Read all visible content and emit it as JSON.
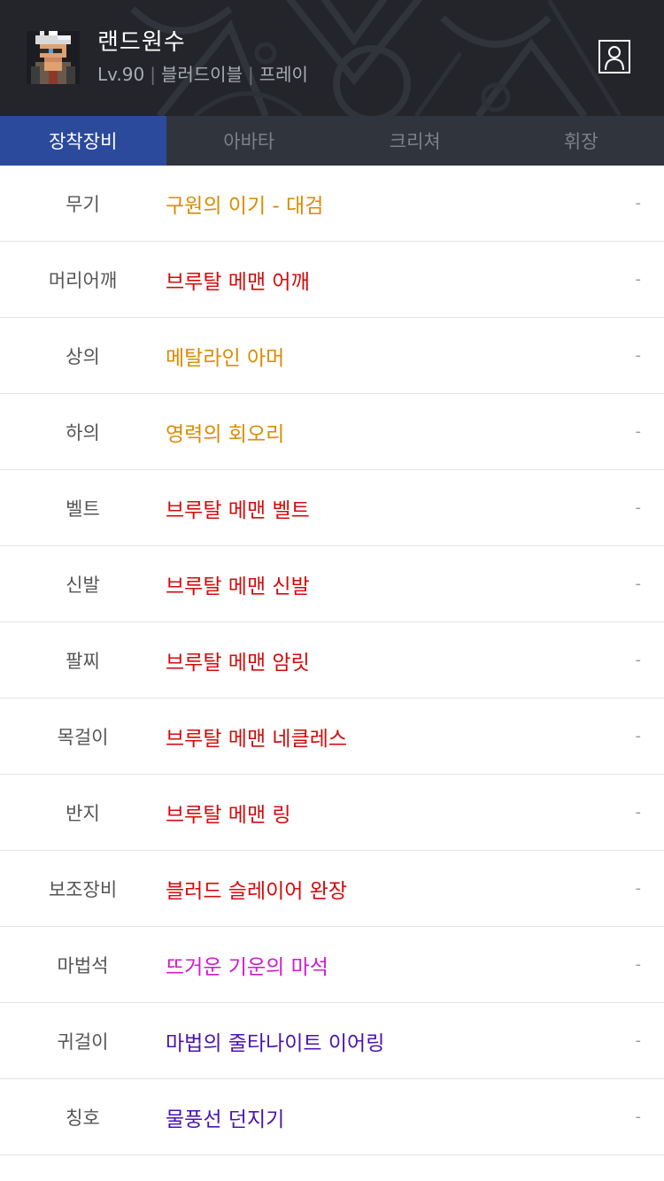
{
  "character": {
    "name": "랜드원수",
    "level": "Lv.90",
    "job": "블러드이블",
    "server": "프레이"
  },
  "icons": {
    "profile": "profile-icon",
    "avatar": "character-avatar"
  },
  "tabs": [
    {
      "label": "장착장비",
      "active": true
    },
    {
      "label": "아바타",
      "active": false
    },
    {
      "label": "크리쳐",
      "active": false
    },
    {
      "label": "휘장",
      "active": false
    }
  ],
  "equipment": [
    {
      "slot": "무기",
      "item": "구원의 이기 - 대검",
      "color": "#d98c00",
      "value": "-"
    },
    {
      "slot": "머리어깨",
      "item": "브루탈 메맨 어깨",
      "color": "#d40b0b",
      "value": "-"
    },
    {
      "slot": "상의",
      "item": "메탈라인 아머",
      "color": "#d98c00",
      "value": "-"
    },
    {
      "slot": "하의",
      "item": "영력의 회오리",
      "color": "#d98c00",
      "value": "-"
    },
    {
      "slot": "벨트",
      "item": "브루탈 메맨 벨트",
      "color": "#d40b0b",
      "value": "-"
    },
    {
      "slot": "신발",
      "item": "브루탈 메맨 신발",
      "color": "#d40b0b",
      "value": "-"
    },
    {
      "slot": "팔찌",
      "item": "브루탈 메맨 암릿",
      "color": "#d40b0b",
      "value": "-"
    },
    {
      "slot": "목걸이",
      "item": "브루탈 메맨 네클레스",
      "color": "#d40b0b",
      "value": "-"
    },
    {
      "slot": "반지",
      "item": "브루탈 메맨 링",
      "color": "#d40b0b",
      "value": "-"
    },
    {
      "slot": "보조장비",
      "item": "블러드 슬레이어 완장",
      "color": "#d40b0b",
      "value": "-"
    },
    {
      "slot": "마법석",
      "item": "뜨거운 기운의 마석",
      "color": "#d11ad1",
      "value": "-"
    },
    {
      "slot": "귀걸이",
      "item": "마법의 줄타나이트 이어링",
      "color": "#4a14b0",
      "value": "-"
    },
    {
      "slot": "칭호",
      "item": "물풍선 던지기",
      "color": "#4a14b0",
      "value": "-"
    }
  ]
}
